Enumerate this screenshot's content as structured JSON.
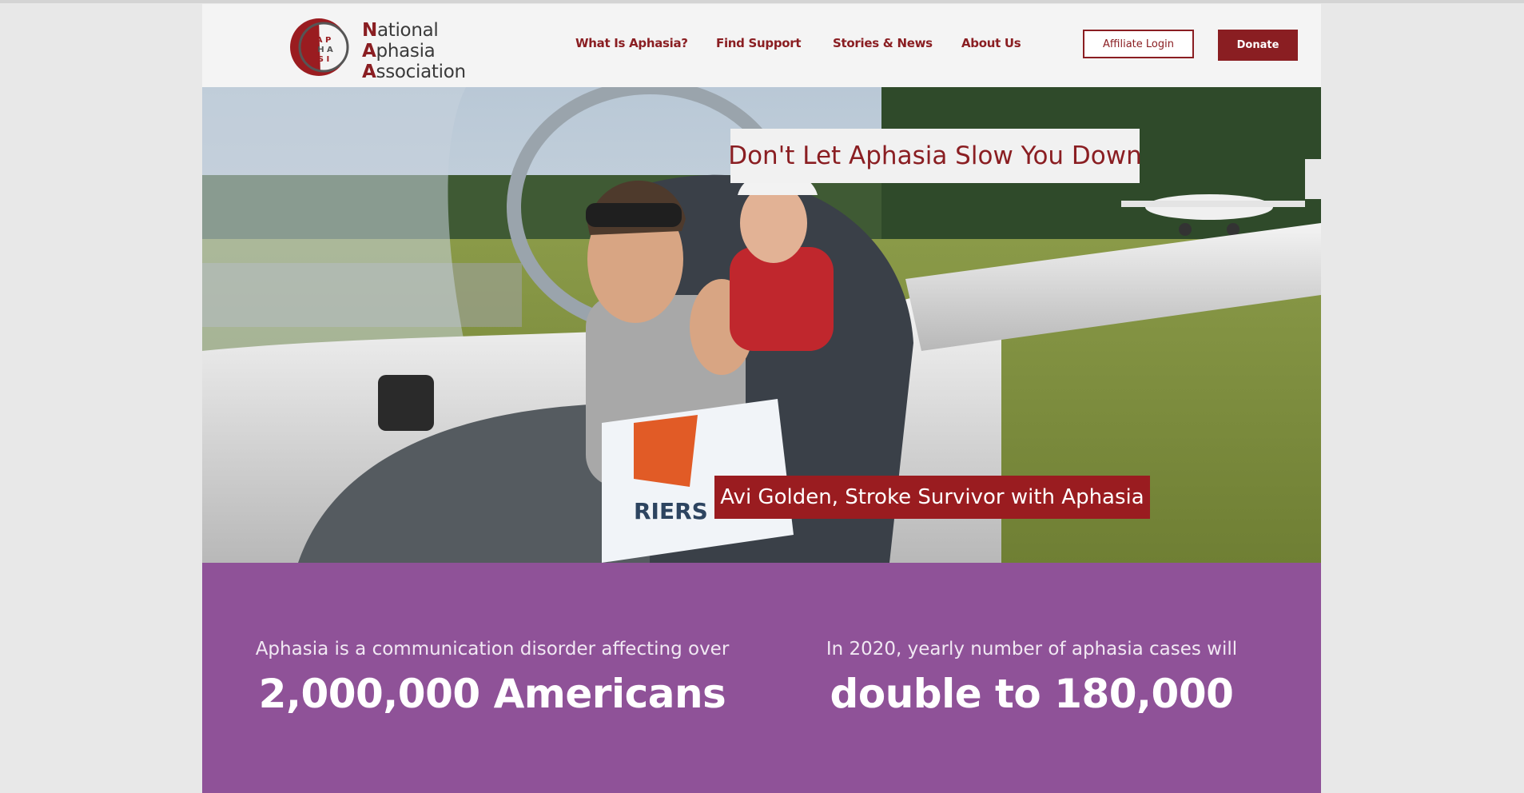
{
  "logo": {
    "line1": "National",
    "line2": "Aphasia",
    "line3": "Association",
    "mark_letters": "APHASIA"
  },
  "nav": {
    "items": [
      {
        "label": "What Is Aphasia?"
      },
      {
        "label": "Find Support"
      },
      {
        "label": "Stories & News"
      },
      {
        "label": "About Us"
      }
    ],
    "affiliate_label": "Affiliate Login",
    "donate_label": "Donate"
  },
  "hero": {
    "title": "Don't Let Aphasia Slow You Down",
    "caption": "Avi Golden, Stroke Survivor with Aphasia",
    "flag_text": "RIERS"
  },
  "stats": [
    {
      "lead": "Aphasia is a communication disorder affecting over",
      "big": "2,000,000 Americans"
    },
    {
      "lead": "In 2020, yearly number of aphasia cases will",
      "big": "double to 180,000"
    }
  ],
  "colors": {
    "brand": "#8a1e22",
    "purple": "#8f5298",
    "page_bg": "#f4f4f4"
  }
}
